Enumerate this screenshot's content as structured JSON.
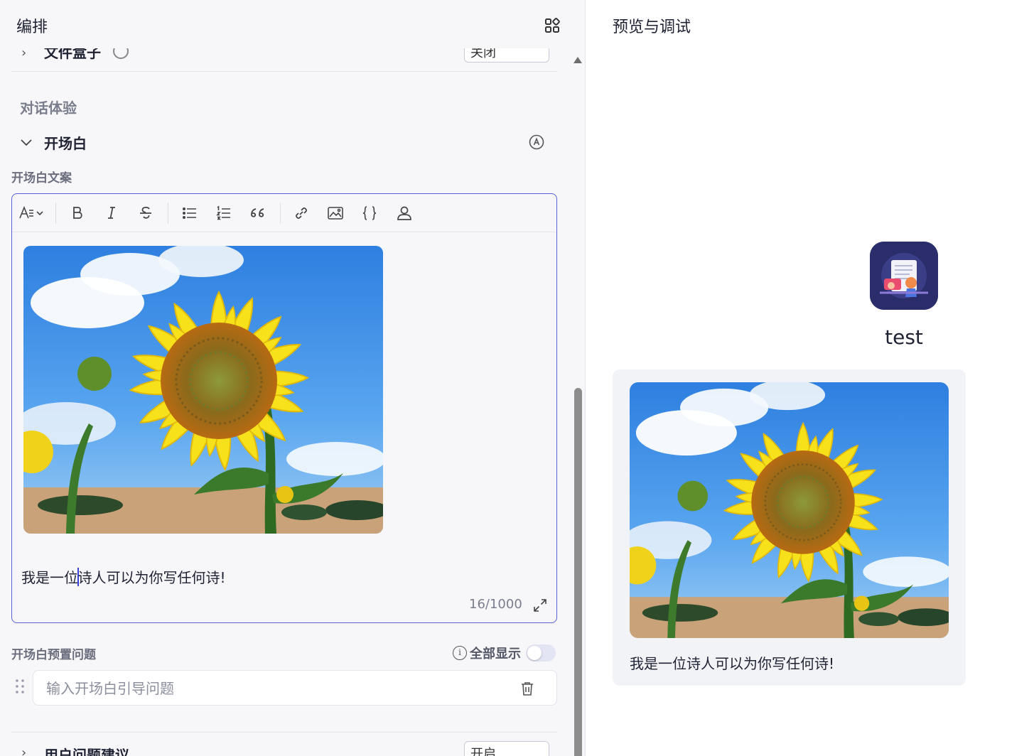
{
  "editor_panel": {
    "title": "编排",
    "layout_icon": "layout-grid-icon",
    "collapsed_row": {
      "label": "文件盒子",
      "select_value": "关闭"
    },
    "section_title": "对话体验",
    "opening_group": {
      "label": "开场白",
      "auto_icon": "auto-mode-icon"
    },
    "opening_text_label": "开场白文案",
    "toolbar_icons": [
      "text-style-icon",
      "bold-icon",
      "italic-icon",
      "strikethrough-icon",
      "bullet-list-icon",
      "numbered-list-icon",
      "quote-icon",
      "link-icon",
      "image-icon",
      "code-braces-icon",
      "user-icon"
    ],
    "content_image": "sunflower-photo",
    "content_text_before": "我是一位",
    "content_text_after": "诗人可以为你写任何诗!",
    "char_counter": "16/1000",
    "preset_questions_label": "开场白预置问题",
    "show_all_label": "全部显示",
    "show_all_enabled": false,
    "question_placeholder": "输入开场白引导问题",
    "next_row": {
      "label": "用户问题建议",
      "select_value": "开启"
    }
  },
  "preview_panel": {
    "title": "预览与调试",
    "bot_name": "test",
    "message_image": "sunflower-photo",
    "message_text": "我是一位诗人可以为你写任何诗!"
  },
  "colors": {
    "accent": "#5b5fd8",
    "panel_bg": "#f7f7fa",
    "avatar_bg": "#2b2d6b"
  }
}
